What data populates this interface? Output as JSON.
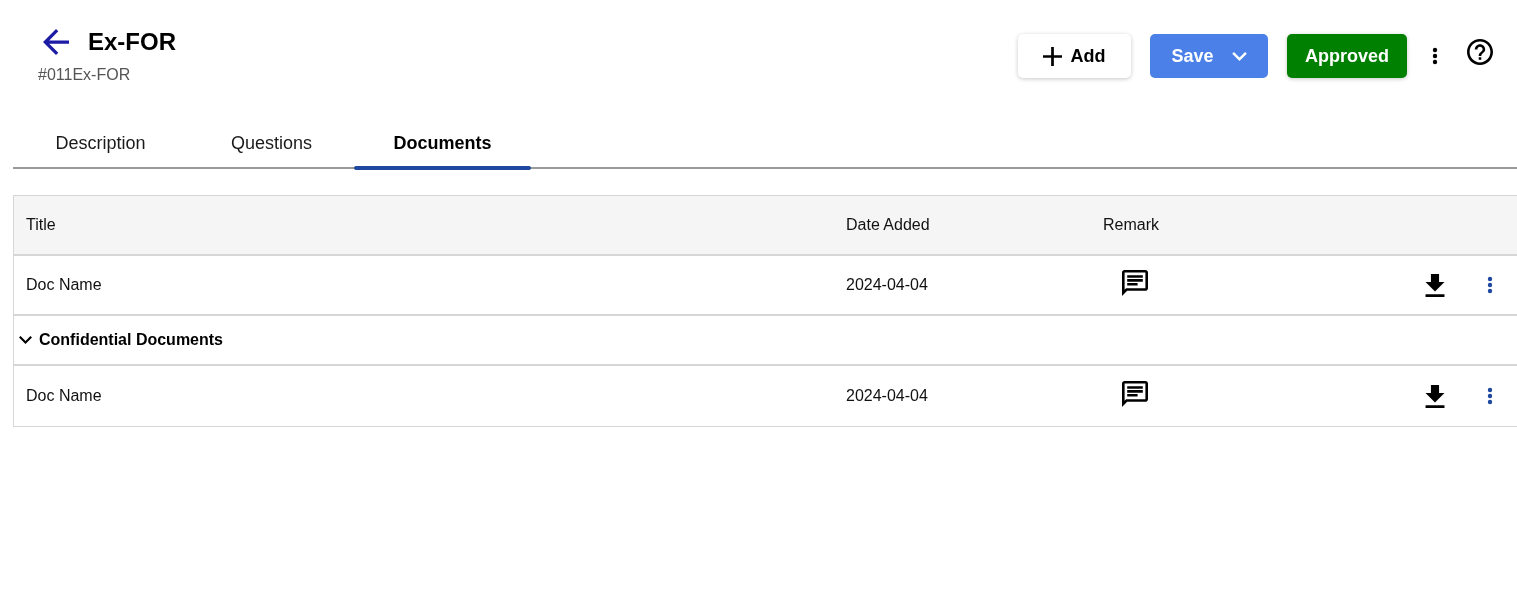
{
  "header": {
    "title": "Ex-FOR",
    "subtitle": "#011Ex-FOR"
  },
  "actions": [
    {
      "kind": "create",
      "label": "Add"
    },
    {
      "kind": "dropdown",
      "label": "Save"
    },
    {
      "kind": "status",
      "label": "Approved"
    }
  ],
  "tabs": [
    {
      "label": "Description",
      "selected": false
    },
    {
      "label": "Questions",
      "selected": false
    },
    {
      "label": "Documents",
      "selected": true
    }
  ],
  "table": {
    "columns": [
      "Title",
      "Date Added",
      "Remark"
    ],
    "rows": [
      {
        "kind": "document",
        "title": "Doc Name",
        "date_added": "2024-04-04"
      },
      {
        "kind": "group",
        "label": "Confidential Documents",
        "expanded": true
      },
      {
        "kind": "document",
        "title": "Doc Name",
        "date_added": "2024-04-04"
      }
    ]
  }
}
